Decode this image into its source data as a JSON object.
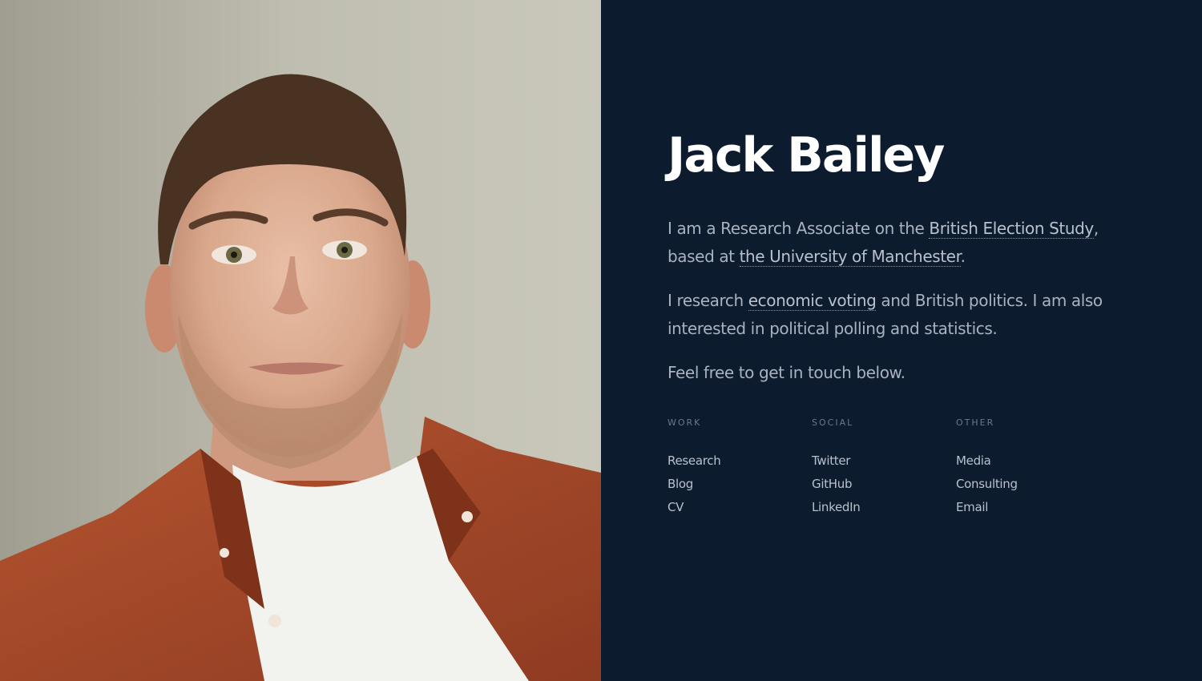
{
  "profile": {
    "name": "Jack Bailey",
    "photo_icon": "portrait-photo"
  },
  "bio": {
    "p1_text_1": "I am a Research Associate on the ",
    "p1_link_1": "British Election Study",
    "p1_text_2": ",",
    "p1_text_3": "based at ",
    "p1_link_2": "the University of Manchester",
    "p1_text_4": ".",
    "p2_text_1": "I research ",
    "p2_link_1": "economic voting",
    "p2_text_2": " and British politics. I am also interested in political polling and statistics.",
    "p3_text": "Feel free to get in touch below."
  },
  "links": {
    "work": {
      "heading": "WORK",
      "items": [
        "Research",
        "Blog",
        "CV"
      ]
    },
    "social": {
      "heading": "SOCIAL",
      "items": [
        "Twitter",
        "GitHub",
        "LinkedIn"
      ]
    },
    "other": {
      "heading": "OTHER",
      "items": [
        "Media",
        "Consulting",
        "Email"
      ]
    }
  },
  "colors": {
    "background": "#0d1b2e",
    "heading": "#ffffff",
    "body_text": "#a9b2c0",
    "muted": "#6d7888",
    "shirt": "#a4482a"
  }
}
